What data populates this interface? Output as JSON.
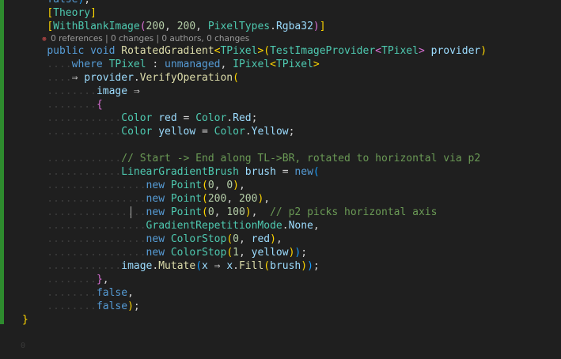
{
  "editor": {
    "lines": [
      {
        "segments": [
          {
            "t": "    ",
            "c": "guide"
          },
          {
            "t": "false",
            "c": "kw"
          },
          {
            "t": ")",
            "c": "br3"
          },
          {
            "t": ";",
            "c": "pun"
          }
        ]
      },
      {
        "segments": [
          {
            "t": "    ",
            "c": "guide"
          },
          {
            "t": "[",
            "c": "br1"
          },
          {
            "t": "Theory",
            "c": "attr"
          },
          {
            "t": "]",
            "c": "br1"
          }
        ]
      },
      {
        "segments": [
          {
            "t": "    ",
            "c": "guide"
          },
          {
            "t": "[",
            "c": "br1"
          },
          {
            "t": "WithBlankImage",
            "c": "attr"
          },
          {
            "t": "(",
            "c": "br2"
          },
          {
            "t": "200",
            "c": "num"
          },
          {
            "t": ", ",
            "c": "pun"
          },
          {
            "t": "200",
            "c": "num"
          },
          {
            "t": ", ",
            "c": "pun"
          },
          {
            "t": "PixelTypes",
            "c": "type"
          },
          {
            "t": ".",
            "c": "pun"
          },
          {
            "t": "Rgba32",
            "c": "var"
          },
          {
            "t": ")",
            "c": "br2"
          },
          {
            "t": "]",
            "c": "br1"
          }
        ]
      },
      {
        "small": true,
        "segments": [
          {
            "t": "    ",
            "c": "guide"
          },
          {
            "t": "⊗ ",
            "c": "err"
          },
          {
            "t": "0 references | 0 changes | 0 authors, 0 changes",
            "c": "lens"
          }
        ]
      },
      {
        "segments": [
          {
            "t": "    ",
            "c": "guide"
          },
          {
            "t": "public ",
            "c": "kw"
          },
          {
            "t": "void ",
            "c": "kw"
          },
          {
            "t": "RotatedGradient",
            "c": "fn"
          },
          {
            "t": "<",
            "c": "br1"
          },
          {
            "t": "TPixel",
            "c": "type"
          },
          {
            "t": ">",
            "c": "br1"
          },
          {
            "t": "(",
            "c": "br1"
          },
          {
            "t": "TestImageProvider",
            "c": "type"
          },
          {
            "t": "<",
            "c": "br2"
          },
          {
            "t": "TPixel",
            "c": "type"
          },
          {
            "t": "> ",
            "c": "br2"
          },
          {
            "t": "provider",
            "c": "var"
          },
          {
            "t": ")",
            "c": "br1"
          }
        ]
      },
      {
        "segments": [
          {
            "t": "    ....",
            "c": "guide"
          },
          {
            "t": "where ",
            "c": "kw"
          },
          {
            "t": "TPixel ",
            "c": "type"
          },
          {
            "t": ": ",
            "c": "pun"
          },
          {
            "t": "unmanaged",
            "c": "kw"
          },
          {
            "t": ", ",
            "c": "pun"
          },
          {
            "t": "IPixel",
            "c": "type"
          },
          {
            "t": "<",
            "c": "br1"
          },
          {
            "t": "TPixel",
            "c": "type"
          },
          {
            "t": ">",
            "c": "br1"
          }
        ]
      },
      {
        "segments": [
          {
            "t": "    ....",
            "c": "guide"
          },
          {
            "t": "⇒ ",
            "c": "pun"
          },
          {
            "t": "provider",
            "c": "var"
          },
          {
            "t": ".",
            "c": "pun"
          },
          {
            "t": "VerifyOperation",
            "c": "fn"
          },
          {
            "t": "(",
            "c": "br1"
          }
        ]
      },
      {
        "segments": [
          {
            "t": "    ....",
            "c": "guide"
          },
          {
            "t": "....",
            "c": "guide"
          },
          {
            "t": "image ",
            "c": "var"
          },
          {
            "t": "⇒",
            "c": "pun"
          }
        ]
      },
      {
        "segments": [
          {
            "t": "    ....",
            "c": "guide"
          },
          {
            "t": "....",
            "c": "guide"
          },
          {
            "t": "{",
            "c": "br2"
          }
        ]
      },
      {
        "segments": [
          {
            "t": "    ....",
            "c": "guide"
          },
          {
            "t": "........",
            "c": "guide"
          },
          {
            "t": "Color ",
            "c": "type"
          },
          {
            "t": "red ",
            "c": "var"
          },
          {
            "t": "= ",
            "c": "pun"
          },
          {
            "t": "Color",
            "c": "type"
          },
          {
            "t": ".",
            "c": "pun"
          },
          {
            "t": "Red",
            "c": "var"
          },
          {
            "t": ";",
            "c": "pun"
          }
        ]
      },
      {
        "segments": [
          {
            "t": "    ....",
            "c": "guide"
          },
          {
            "t": "........",
            "c": "guide"
          },
          {
            "t": "Color ",
            "c": "type"
          },
          {
            "t": "yellow ",
            "c": "var"
          },
          {
            "t": "= ",
            "c": "pun"
          },
          {
            "t": "Color",
            "c": "type"
          },
          {
            "t": ".",
            "c": "pun"
          },
          {
            "t": "Yellow",
            "c": "var"
          },
          {
            "t": ";",
            "c": "pun"
          }
        ]
      },
      {
        "segments": [
          {
            "t": "",
            "c": "pun"
          }
        ]
      },
      {
        "segments": [
          {
            "t": "    ....",
            "c": "guide"
          },
          {
            "t": "........",
            "c": "guide"
          },
          {
            "t": "// Start -> End along TL->BR, rotated to horizontal via p2",
            "c": "cm"
          }
        ]
      },
      {
        "segments": [
          {
            "t": "    ....",
            "c": "guide"
          },
          {
            "t": "........",
            "c": "guide"
          },
          {
            "t": "LinearGradientBrush ",
            "c": "type"
          },
          {
            "t": "brush ",
            "c": "var"
          },
          {
            "t": "= ",
            "c": "pun"
          },
          {
            "t": "new",
            "c": "kw"
          },
          {
            "t": "(",
            "c": "br3"
          }
        ]
      },
      {
        "segments": [
          {
            "t": "    ....",
            "c": "guide"
          },
          {
            "t": "............",
            "c": "guide"
          },
          {
            "t": "new ",
            "c": "kw"
          },
          {
            "t": "Point",
            "c": "type"
          },
          {
            "t": "(",
            "c": "br1"
          },
          {
            "t": "0",
            "c": "num"
          },
          {
            "t": ", ",
            "c": "pun"
          },
          {
            "t": "0",
            "c": "num"
          },
          {
            "t": ")",
            "c": "br1"
          },
          {
            "t": ",",
            "c": "pun"
          }
        ]
      },
      {
        "segments": [
          {
            "t": "    ....",
            "c": "guide"
          },
          {
            "t": "............",
            "c": "guide"
          },
          {
            "t": "new ",
            "c": "kw"
          },
          {
            "t": "Point",
            "c": "type"
          },
          {
            "t": "(",
            "c": "br1"
          },
          {
            "t": "200",
            "c": "num"
          },
          {
            "t": ", ",
            "c": "pun"
          },
          {
            "t": "200",
            "c": "num"
          },
          {
            "t": ")",
            "c": "br1"
          },
          {
            "t": ",",
            "c": "pun"
          }
        ]
      },
      {
        "caret": true,
        "segments": [
          {
            "t": "    ....",
            "c": "guide"
          },
          {
            "t": "............",
            "c": "guide"
          },
          {
            "t": "new ",
            "c": "kw"
          },
          {
            "t": "Point",
            "c": "type"
          },
          {
            "t": "(",
            "c": "br1"
          },
          {
            "t": "0",
            "c": "num"
          },
          {
            "t": ", ",
            "c": "pun"
          },
          {
            "t": "100",
            "c": "num"
          },
          {
            "t": ")",
            "c": "br1"
          },
          {
            "t": ",  ",
            "c": "pun"
          },
          {
            "t": "// p2 picks horizontal axis",
            "c": "cm"
          }
        ]
      },
      {
        "segments": [
          {
            "t": "    ....",
            "c": "guide"
          },
          {
            "t": "............",
            "c": "guide"
          },
          {
            "t": "GradientRepetitionMode",
            "c": "type"
          },
          {
            "t": ".",
            "c": "pun"
          },
          {
            "t": "None",
            "c": "var"
          },
          {
            "t": ",",
            "c": "pun"
          }
        ]
      },
      {
        "segments": [
          {
            "t": "    ....",
            "c": "guide"
          },
          {
            "t": "............",
            "c": "guide"
          },
          {
            "t": "new ",
            "c": "kw"
          },
          {
            "t": "ColorStop",
            "c": "type"
          },
          {
            "t": "(",
            "c": "br1"
          },
          {
            "t": "0",
            "c": "num"
          },
          {
            "t": ", ",
            "c": "pun"
          },
          {
            "t": "red",
            "c": "var"
          },
          {
            "t": ")",
            "c": "br1"
          },
          {
            "t": ",",
            "c": "pun"
          }
        ]
      },
      {
        "segments": [
          {
            "t": "    ....",
            "c": "guide"
          },
          {
            "t": "............",
            "c": "guide"
          },
          {
            "t": "new ",
            "c": "kw"
          },
          {
            "t": "ColorStop",
            "c": "type"
          },
          {
            "t": "(",
            "c": "br1"
          },
          {
            "t": "1",
            "c": "num"
          },
          {
            "t": ", ",
            "c": "pun"
          },
          {
            "t": "yellow",
            "c": "var"
          },
          {
            "t": ")",
            "c": "br1"
          },
          {
            "t": ")",
            "c": "br3"
          },
          {
            "t": ";",
            "c": "pun"
          }
        ]
      },
      {
        "segments": [
          {
            "t": "    ....",
            "c": "guide"
          },
          {
            "t": "........",
            "c": "guide"
          },
          {
            "t": "image",
            "c": "var"
          },
          {
            "t": ".",
            "c": "pun"
          },
          {
            "t": "Mutate",
            "c": "fn"
          },
          {
            "t": "(",
            "c": "br3"
          },
          {
            "t": "x ",
            "c": "var"
          },
          {
            "t": "⇒ ",
            "c": "pun"
          },
          {
            "t": "x",
            "c": "var"
          },
          {
            "t": ".",
            "c": "pun"
          },
          {
            "t": "Fill",
            "c": "fn"
          },
          {
            "t": "(",
            "c": "br1"
          },
          {
            "t": "brush",
            "c": "var"
          },
          {
            "t": ")",
            "c": "br1"
          },
          {
            "t": ")",
            "c": "br3"
          },
          {
            "t": ";",
            "c": "pun"
          }
        ]
      },
      {
        "segments": [
          {
            "t": "    ....",
            "c": "guide"
          },
          {
            "t": "....",
            "c": "guide"
          },
          {
            "t": "}",
            "c": "br2"
          },
          {
            "t": ",",
            "c": "pun"
          }
        ]
      },
      {
        "segments": [
          {
            "t": "    ....",
            "c": "guide"
          },
          {
            "t": "....",
            "c": "guide"
          },
          {
            "t": "false",
            "c": "kw"
          },
          {
            "t": ",",
            "c": "pun"
          }
        ]
      },
      {
        "segments": [
          {
            "t": "    ....",
            "c": "guide"
          },
          {
            "t": "....",
            "c": "guide"
          },
          {
            "t": "false",
            "c": "kw"
          },
          {
            "t": ")",
            "c": "br1"
          },
          {
            "t": ";",
            "c": "pun"
          }
        ]
      },
      {
        "segments": [
          {
            "t": "}",
            "c": "br1"
          }
        ]
      }
    ],
    "trailing_line_number": "0"
  }
}
